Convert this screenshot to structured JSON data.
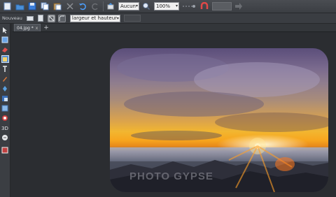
{
  "toolbar": {
    "zoom_value": "100%",
    "select_value": "Aucun",
    "size_value": ""
  },
  "toolbar2": {
    "new_label": "Nouveau",
    "mode_value": "largeur et hauteur"
  },
  "tabs": [
    {
      "label": "04.jpg *",
      "close": "x"
    }
  ],
  "tab_add": "+",
  "image": {
    "watermark": "PHOTO GYPSE"
  },
  "colors": {
    "toolbar_bg": "#3b3e43",
    "canvas_bg": "#2b2d31",
    "sun": "#fff3c4",
    "sky_gold": "#f2b630"
  }
}
